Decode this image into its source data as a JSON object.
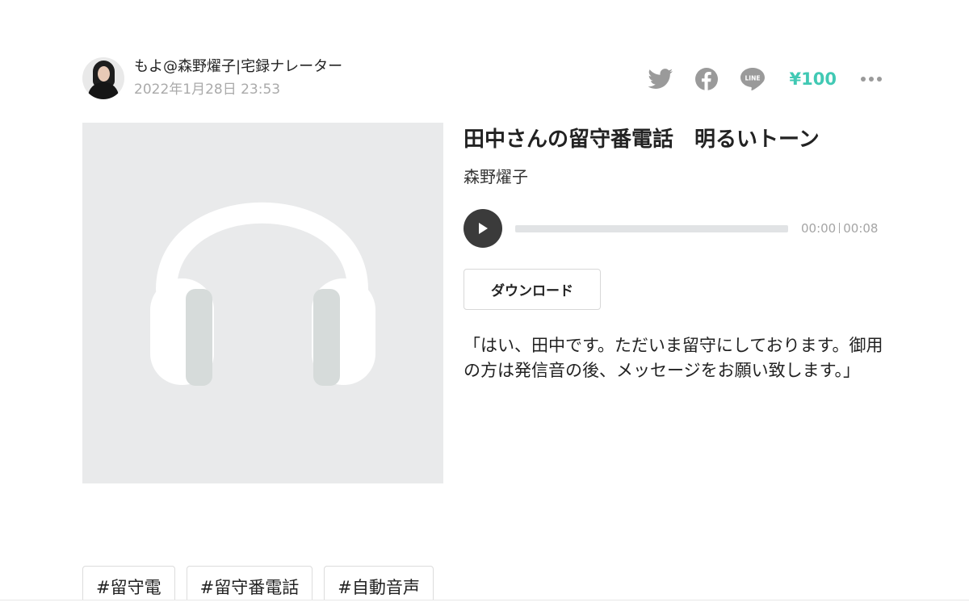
{
  "author": {
    "name": "もよ@森野燿子|宅録ナレーター",
    "date": "2022年1月28日 23:53"
  },
  "actions": {
    "icons": [
      "twitter-icon",
      "facebook-icon",
      "line-icon"
    ],
    "price": "¥100",
    "more_icon": "more-icon"
  },
  "cover": {
    "icon": "headphones-icon",
    "colors": {
      "background": "#e9eaeb",
      "headphones": "#ffffff",
      "cushions": "#d6dbda"
    }
  },
  "audio": {
    "title": "田中さんの留守番電話　明るいトーン",
    "artist": "森野燿子",
    "current_time": "00:00",
    "duration": "00:08",
    "progress": 0,
    "download_label": "ダウンロード"
  },
  "description": "「はい、田中です。ただいま留守にしております。御用の方は発信音の後、メッセージをお願い致します。」",
  "tags": [
    "#留守電",
    "#留守番電話",
    "#自動音声"
  ],
  "colors": {
    "accent": "#41c9b4",
    "icon_gray": "#9a9a9a",
    "text": "#222222",
    "meta": "#aaaaaa"
  }
}
